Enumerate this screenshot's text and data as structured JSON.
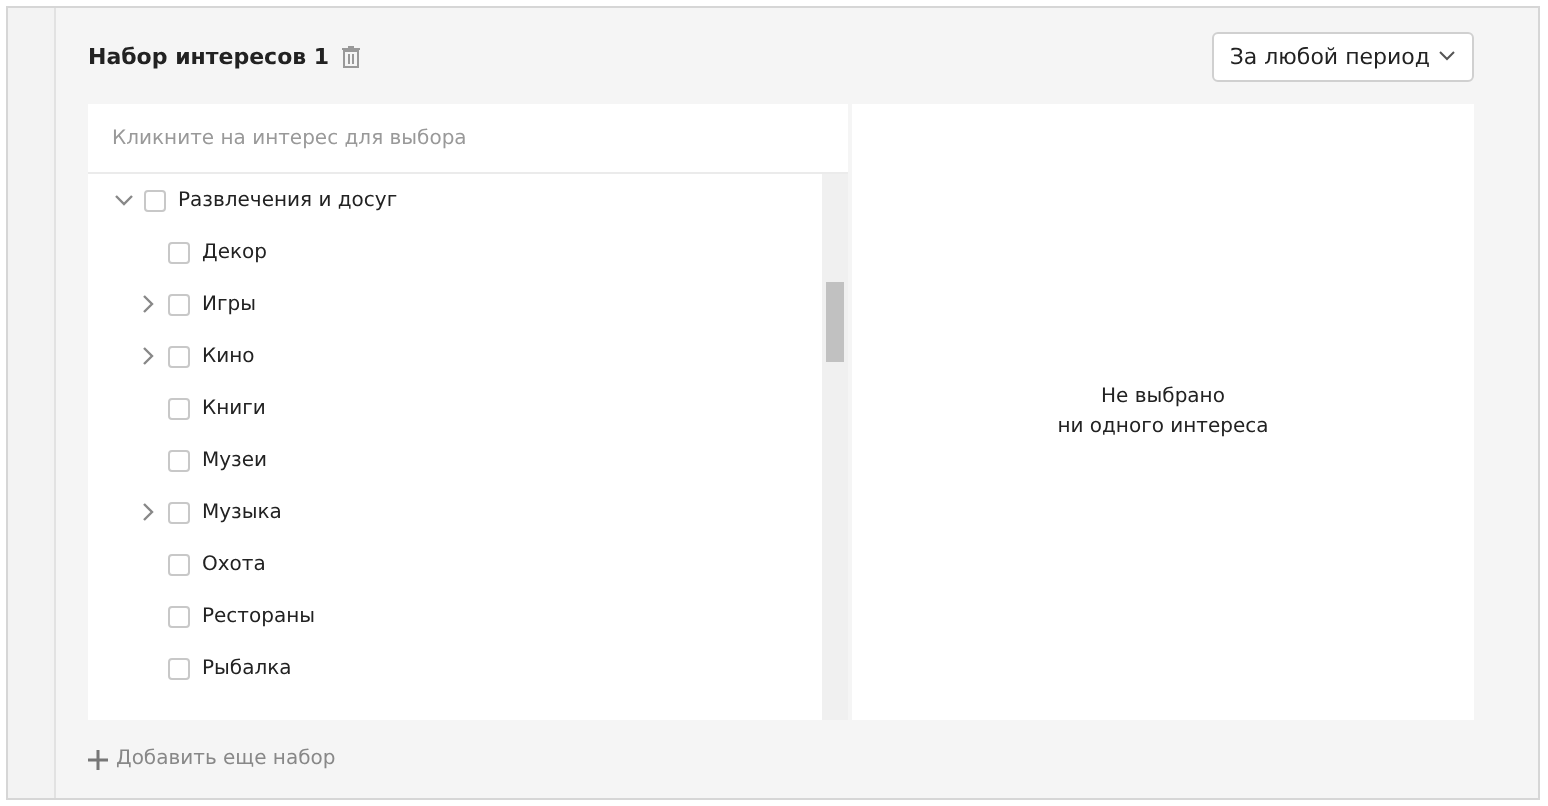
{
  "set": {
    "title": "Набор интересов 1",
    "period": "За любой период"
  },
  "tree": {
    "placeholder": "Кликните на интерес для выбора",
    "items": [
      {
        "label": "Развлечения и досуг",
        "kind": "branch",
        "expanded": true,
        "checked": false,
        "children": [
          {
            "label": "Декор",
            "kind": "leaf",
            "checked": false
          },
          {
            "label": "Игры",
            "kind": "branch",
            "expanded": false,
            "checked": false
          },
          {
            "label": "Кино",
            "kind": "branch",
            "expanded": false,
            "checked": false
          },
          {
            "label": "Книги",
            "kind": "leaf",
            "checked": false
          },
          {
            "label": "Музеи",
            "kind": "leaf",
            "checked": false
          },
          {
            "label": "Музыка",
            "kind": "branch",
            "expanded": false,
            "checked": false
          },
          {
            "label": "Охота",
            "kind": "leaf",
            "checked": false
          },
          {
            "label": "Рестораны",
            "kind": "leaf",
            "checked": false
          },
          {
            "label": "Рыбалка",
            "kind": "leaf",
            "checked": false
          }
        ]
      }
    ]
  },
  "selection": {
    "empty_lines": [
      "Не выбрано",
      "ни одного интереса"
    ]
  },
  "add_set": "Добавить еще набор"
}
